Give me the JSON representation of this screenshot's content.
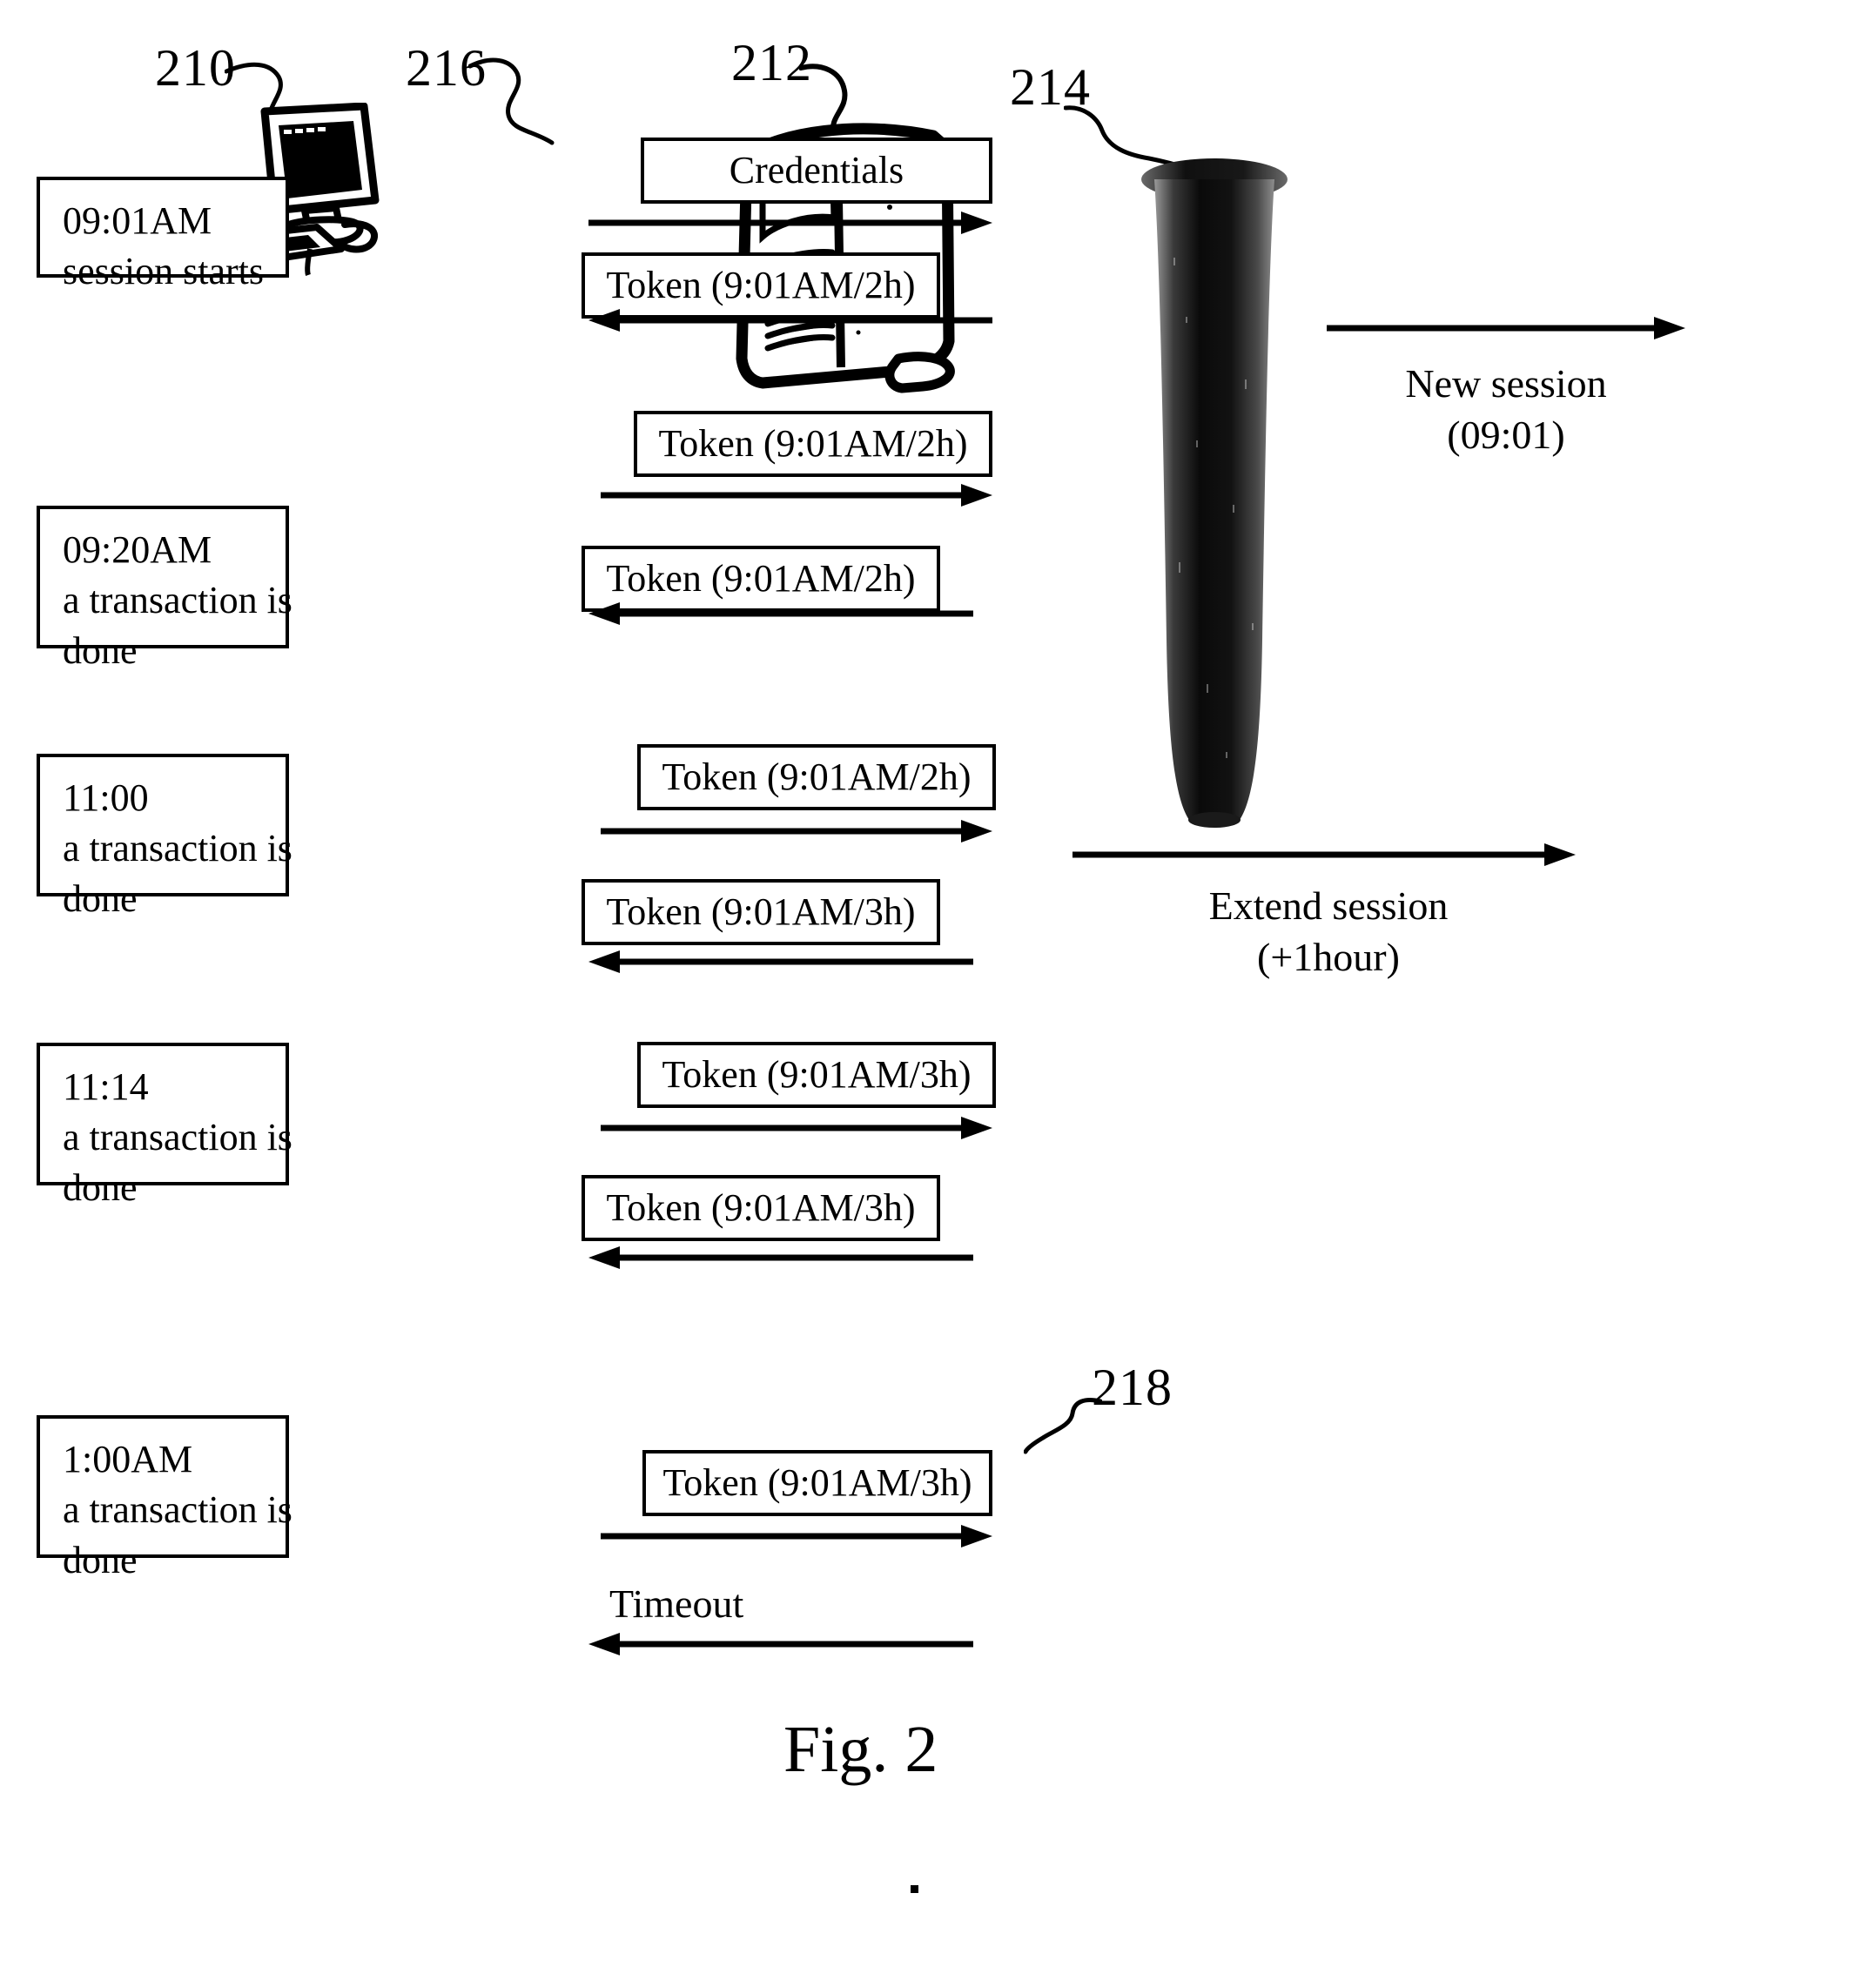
{
  "figure": {
    "caption": "Fig. 2"
  },
  "reference_numerals": [
    {
      "id": "210",
      "label": "210",
      "target": "client-workstation"
    },
    {
      "id": "216",
      "label": "216",
      "target": "credentials-message"
    },
    {
      "id": "212",
      "label": "212",
      "target": "server-tower"
    },
    {
      "id": "214",
      "label": "214",
      "target": "session-store-cylinder"
    },
    {
      "id": "218",
      "label": "218",
      "target": "final-token-message"
    }
  ],
  "events": [
    {
      "time": "09:01AM",
      "line2": "session starts",
      "line3": ""
    },
    {
      "time": "09:20AM",
      "line2": "a transaction is",
      "line3": "done"
    },
    {
      "time": "11:00",
      "line2": "a transaction is",
      "line3": "done"
    },
    {
      "time": "11:14",
      "line2": "a transaction is",
      "line3": "done"
    },
    {
      "time": "1:00AM",
      "line2": "a transaction is",
      "line3": "done"
    }
  ],
  "messages": [
    {
      "label": "Credentials",
      "direction": "right"
    },
    {
      "label": "Token (9:01AM/2h)",
      "direction": "left"
    },
    {
      "label": "Token (9:01AM/2h)",
      "direction": "right"
    },
    {
      "label": "Token (9:01AM/2h)",
      "direction": "left"
    },
    {
      "label": "Token (9:01AM/2h)",
      "direction": "right"
    },
    {
      "label": "Token (9:01AM/3h)",
      "direction": "left"
    },
    {
      "label": "Token (9:01AM/3h)",
      "direction": "right"
    },
    {
      "label": "Token (9:01AM/3h)",
      "direction": "left"
    },
    {
      "label": "Token (9:01AM/3h)",
      "direction": "right"
    },
    {
      "label": "Timeout",
      "direction": "left"
    }
  ],
  "session_actions": [
    {
      "line1": "New session",
      "line2": "(09:01)",
      "direction": "right"
    },
    {
      "line1": "Extend session",
      "line2": "(+1hour)",
      "direction": "right"
    }
  ],
  "timeout_label": "Timeout",
  "icons": {
    "client": "desktop-computer-icon",
    "server": "server-tower-icon",
    "store": "database-cylinder-icon"
  },
  "colors": {
    "ink": "#000000",
    "paper": "#ffffff"
  }
}
